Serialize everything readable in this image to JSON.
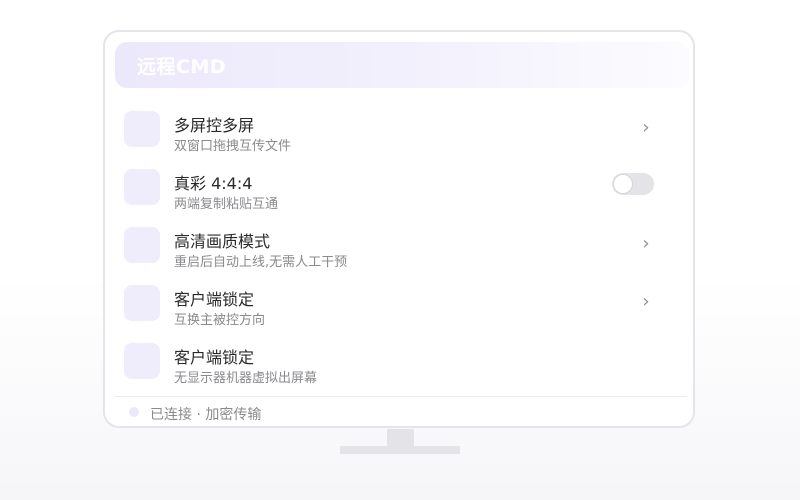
{
  "window": {
    "title": "远程CMD"
  },
  "settings": [
    {
      "title": "多屏控多屏",
      "subtitle": "双窗口拖拽互传文件",
      "control": "chevron",
      "chevron": "›"
    },
    {
      "title": "真彩 4:4:4",
      "subtitle": "两端复制粘贴互通",
      "control": "toggle",
      "toggle_on": false
    },
    {
      "title": "高清画质模式",
      "subtitle": "重启后自动上线,无需人工干预",
      "control": "chevron",
      "chevron": "›"
    },
    {
      "title": "客户端锁定",
      "subtitle": "互换主被控方向",
      "control": "chevron",
      "chevron": "›"
    },
    {
      "title": "客户端锁定",
      "subtitle": "无显示器机器虚拟出屏幕",
      "control": "none"
    }
  ],
  "status": {
    "text": "已连接 · 加密传输"
  },
  "colors": {
    "accent_light": "#efecfc",
    "toggle_off": "#e3e3e8",
    "frame": "#e4e4ea"
  }
}
